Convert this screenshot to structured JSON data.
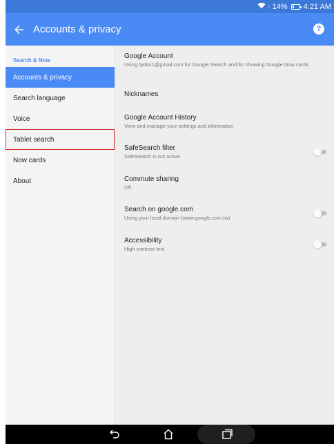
{
  "status_bar": {
    "battery_percent": "14%",
    "time": "4:21 AM",
    "wifi_icon": "wifi-icon",
    "battery_icon": "battery-icon"
  },
  "app_bar": {
    "title": "Accounts & privacy",
    "back_icon": "arrow-back-icon",
    "help_icon": "help-icon"
  },
  "sidebar": {
    "header": "Search & Now",
    "items": [
      {
        "label": "Accounts & privacy",
        "active": true
      },
      {
        "label": "Search language"
      },
      {
        "label": "Voice"
      },
      {
        "label": "Tablet search",
        "outlined": true
      },
      {
        "label": "Now cards"
      },
      {
        "label": "About"
      }
    ]
  },
  "settings": [
    {
      "title": "Google Account",
      "subtitle": "Using tpdoc1@gmail.com for Google Search and for showing Google Now cards"
    },
    {
      "title": "Nicknames"
    },
    {
      "title": "Google Account History",
      "subtitle": "View and manage your settings and information"
    },
    {
      "title": "SafeSearch filter",
      "subtitle": "SafeSearch is not active",
      "toggle": false
    },
    {
      "title": "Commute sharing",
      "subtitle": "Off"
    },
    {
      "title": "Search on google.com",
      "subtitle": "Using your local domain (www.google.com.tw)",
      "toggle": false
    },
    {
      "title": "Accessibility",
      "subtitle": "High contrast text",
      "toggle": false
    }
  ],
  "colors": {
    "status_bar": "#3b78d8",
    "app_bar": "#4a8af4",
    "active_item": "#4a8af4",
    "outline": "#d32f2f"
  },
  "nav_bar": {
    "back_icon": "nav-back-icon",
    "home_icon": "nav-home-icon",
    "recents_icon": "nav-recents-icon"
  }
}
